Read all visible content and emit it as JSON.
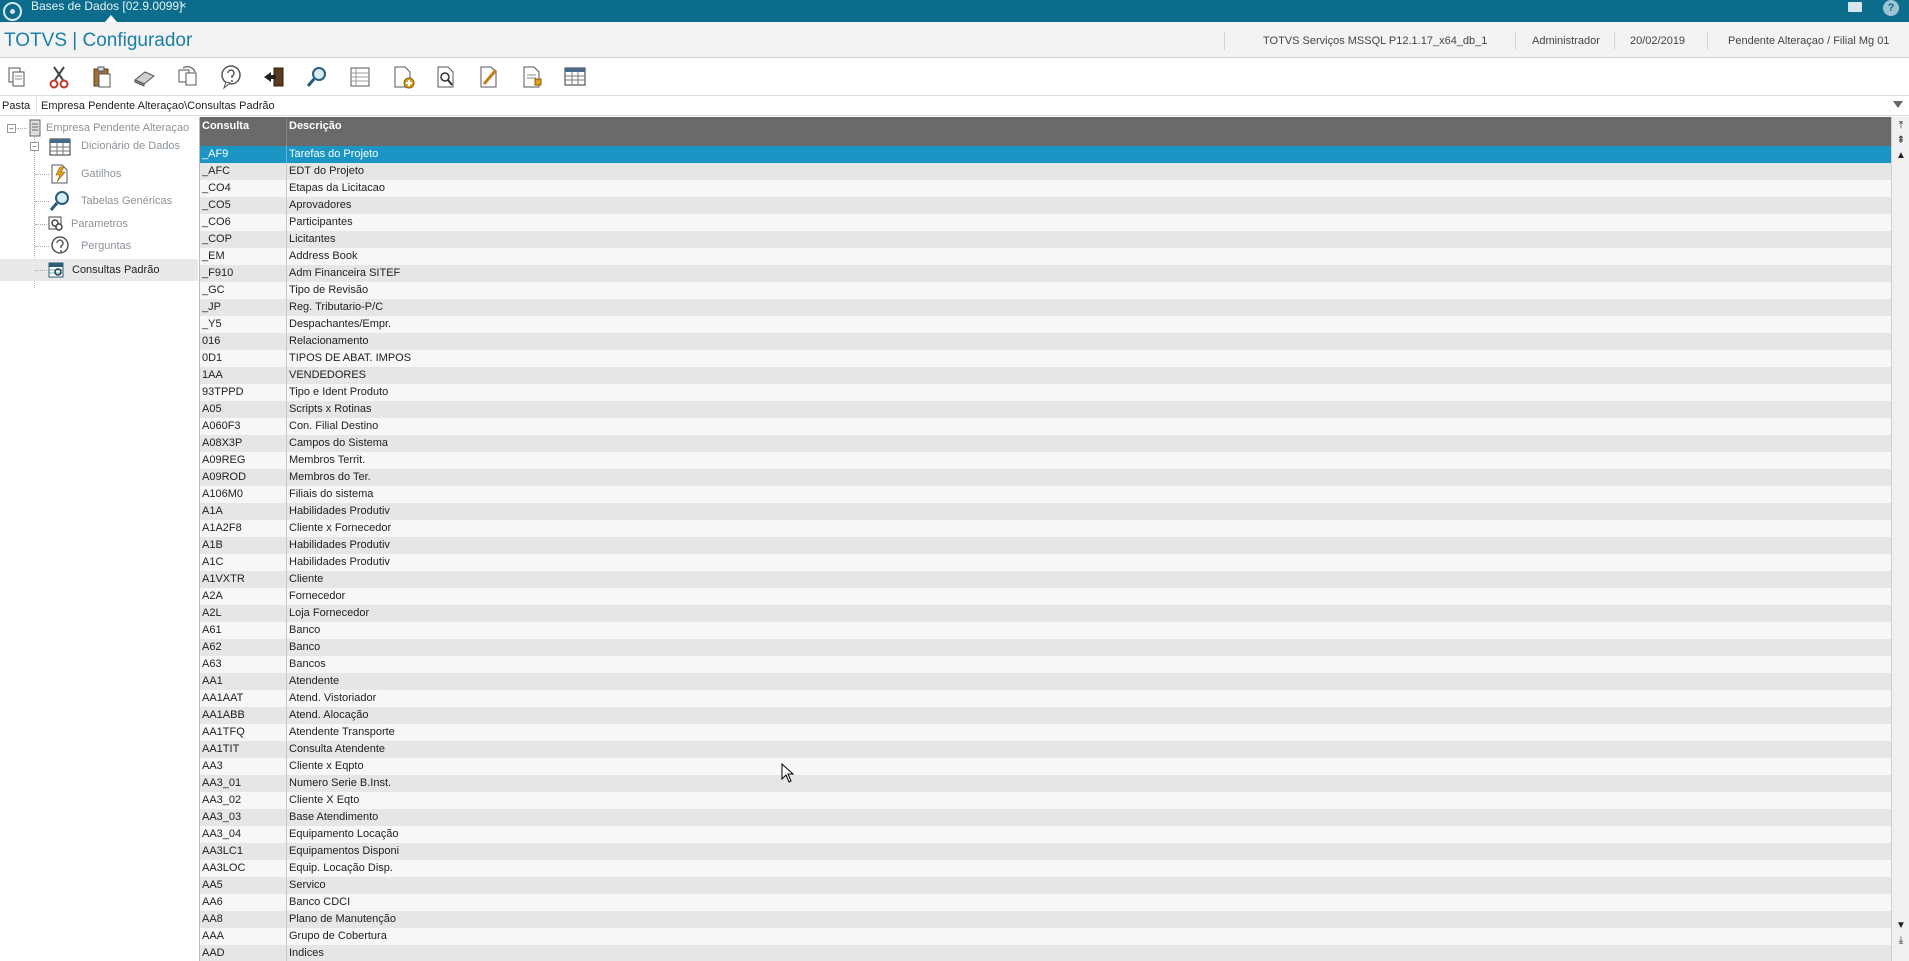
{
  "topbar": {
    "tab_title": "Bases de Dados [02.9.0099]",
    "tab_close": "×"
  },
  "header": {
    "app_title": "TOTVS | Configurador",
    "environment": "TOTVS Serviços MSSQL P12.1.17_x64_db_1",
    "user": "Administrador",
    "date": "20/02/2019",
    "company": "Pendente Alteraçao / Filial Mg 01"
  },
  "toolbar": {
    "buttons": [
      "copy-icon",
      "cut-icon",
      "paste-icon",
      "eraser-icon",
      "refresh-icon",
      "help-icon",
      "exit-icon",
      "search-icon",
      "list-icon",
      "add-document-icon",
      "view-document-icon",
      "edit-icon",
      "document-icon",
      "table-icon"
    ]
  },
  "pasta": {
    "label": "Pasta",
    "path": "Empresa Pendente Alteraçao\\Consultas Padrão"
  },
  "tree": {
    "root": "Empresa Pendente Alteraçao",
    "items": [
      {
        "label": "Dicionário de Dados",
        "icon": "table-icon"
      },
      {
        "label": "Gatilhos",
        "icon": "trigger-icon"
      },
      {
        "label": "Tabelas Genéricas",
        "icon": "magnifier-icon"
      },
      {
        "label": "Parametros",
        "icon": "parameters-icon"
      },
      {
        "label": "Perguntas",
        "icon": "question-icon"
      },
      {
        "label": "Consultas Padrão",
        "icon": "query-icon"
      }
    ]
  },
  "grid": {
    "columns": [
      "Consulta",
      "Descrição"
    ],
    "selected_index": 0,
    "rows": [
      [
        "_AF9",
        "Tarefas do Projeto"
      ],
      [
        "_AFC",
        "EDT do Projeto"
      ],
      [
        "_CO4",
        "Etapas da Licitacao"
      ],
      [
        "_CO5",
        "Aprovadores"
      ],
      [
        "_CO6",
        "Participantes"
      ],
      [
        "_COP",
        "Licitantes"
      ],
      [
        "_EM",
        "Address Book"
      ],
      [
        "_F910",
        "Adm Financeira SITEF"
      ],
      [
        "_GC",
        "Tipo de Revisão"
      ],
      [
        "_JP",
        "Reg. Tributario-P/C"
      ],
      [
        "_Y5",
        "Despachantes/Empr."
      ],
      [
        "016",
        "Relacionamento"
      ],
      [
        "0D1",
        "TIPOS DE ABAT. IMPOS"
      ],
      [
        "1AA",
        "VENDEDORES"
      ],
      [
        "93TPPD",
        "Tipo e Ident Produto"
      ],
      [
        "A05",
        "Scripts x Rotinas"
      ],
      [
        "A060F3",
        "Con. Filial Destino"
      ],
      [
        "A08X3P",
        "Campos do Sistema"
      ],
      [
        "A09REG",
        "Membros Territ."
      ],
      [
        "A09ROD",
        "Membros do Ter."
      ],
      [
        "A106M0",
        "Filiais do sistema"
      ],
      [
        "A1A",
        "Habilidades Produtiv"
      ],
      [
        "A1A2F8",
        "Cliente x Fornecedor"
      ],
      [
        "A1B",
        "Habilidades Produtiv"
      ],
      [
        "A1C",
        "Habilidades Produtiv"
      ],
      [
        "A1VXTR",
        "Cliente"
      ],
      [
        "A2A",
        "Fornecedor"
      ],
      [
        "A2L",
        "Loja Fornecedor"
      ],
      [
        "A61",
        "Banco"
      ],
      [
        "A62",
        "Banco"
      ],
      [
        "A63",
        "Bancos"
      ],
      [
        "AA1",
        "Atendente"
      ],
      [
        "AA1AAT",
        "Atend. Vistoriador"
      ],
      [
        "AA1ABB",
        "Atend. Alocação"
      ],
      [
        "AA1TFQ",
        "Atendente Transporte"
      ],
      [
        "AA1TIT",
        "Consulta Atendente"
      ],
      [
        "AA3",
        "Cliente x Eqpto"
      ],
      [
        "AA3_01",
        "Numero Serie B.Inst."
      ],
      [
        "AA3_02",
        "Cliente X Eqto"
      ],
      [
        "AA3_03",
        "Base Atendimento"
      ],
      [
        "AA3_04",
        "Equipamento Locação"
      ],
      [
        "AA3LC1",
        "Equipamentos Disponi"
      ],
      [
        "AA3LOC",
        "Equip. Locação Disp."
      ],
      [
        "AA5",
        "Servico"
      ],
      [
        "AA6",
        "Banco CDCI"
      ],
      [
        "AA8",
        "Plano de Manutenção"
      ],
      [
        "AAA",
        "Grupo de Cobertura"
      ],
      [
        "AAD",
        "Indices"
      ]
    ]
  }
}
